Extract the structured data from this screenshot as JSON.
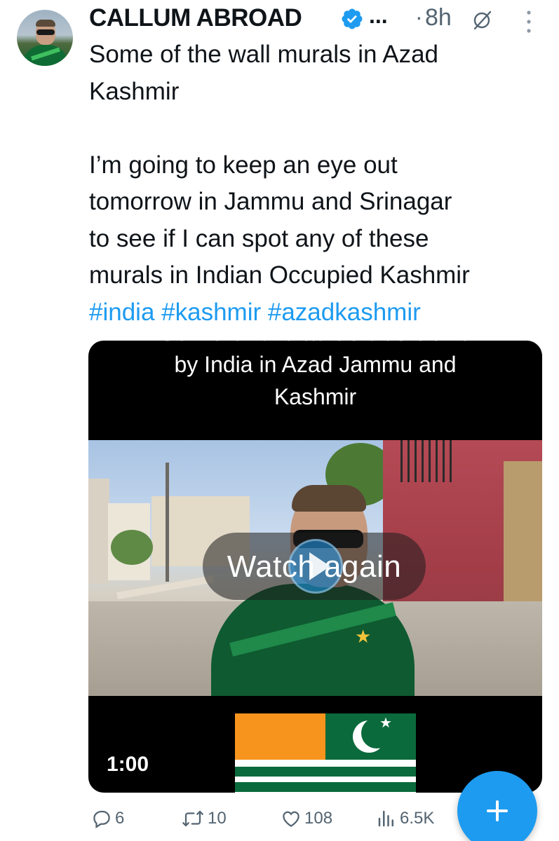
{
  "author": {
    "name": "CALLUM ABROAD",
    "verified": true,
    "name_ellipsis": "...",
    "separator": "·",
    "time": "8h"
  },
  "tweet": {
    "lines_para1": [
      "Some of the wall murals in Azad",
      "Kashmir"
    ],
    "lines_para2": [
      "I’m going to keep an eye out",
      "tomorrow in Jammu and Srinagar",
      "to see if I can spot any of these",
      "murals in Indian Occupied Kashmir"
    ],
    "hashtags": [
      "#india",
      "#kashmir",
      "#azadkashmir"
    ]
  },
  "media": {
    "caption_cut": "Some of the atrocities done",
    "caption_line1": "by India in Azad Jammu and",
    "caption_line2": "Kashmir",
    "overlay_label": "Watch again",
    "duration": "1:00"
  },
  "actions": {
    "replies": "6",
    "reposts": "10",
    "likes": "108",
    "views": "6.5K"
  },
  "icons": {
    "verified": "verified-badge-icon",
    "grok": "grok-icon",
    "more": "more-vertical-icon",
    "reply": "reply-icon",
    "repost": "repost-icon",
    "like": "heart-icon",
    "views": "views-icon",
    "compose": "plus-icon"
  },
  "colors": {
    "accent": "#1d9bf0",
    "text": "#0f1419",
    "muted": "#536471"
  }
}
